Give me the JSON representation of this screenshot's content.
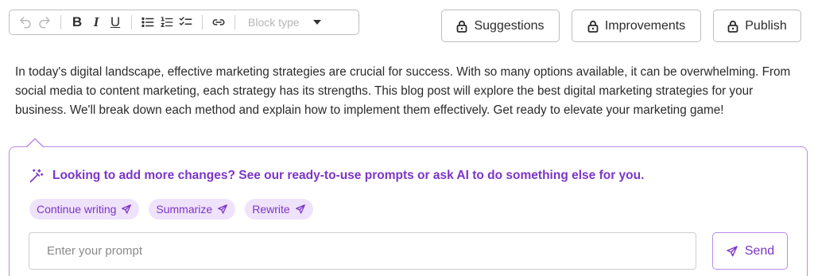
{
  "toolbar": {
    "undo_icon": "undo-icon",
    "redo_icon": "redo-icon",
    "bold_label": "B",
    "italic_label": "I",
    "underline_label": "U",
    "bullet_list_icon": "bullet-list-icon",
    "numbered_list_icon": "numbered-list-icon",
    "checklist_icon": "checklist-icon",
    "link_icon": "link-icon",
    "block_type_placeholder": "Block type"
  },
  "actions": {
    "suggestions": {
      "label": "Suggestions",
      "icon": "lock-icon"
    },
    "improvements": {
      "label": "Improvements",
      "icon": "lock-icon"
    },
    "publish": {
      "label": "Publish",
      "icon": "lock-icon"
    }
  },
  "content": {
    "paragraph": "In today's digital landscape, effective marketing strategies are crucial for success. With so many options available, it can be overwhelming. From social media to content marketing, each strategy has its strengths. This blog post will explore the best digital marketing strategies for your business. We'll break down each method and explain how to implement them effectively. Get ready to elevate your marketing game!"
  },
  "ai_panel": {
    "headline": "Looking to add more changes? See our ready-to-use prompts or ask AI to do something else for you.",
    "headline_icon": "magic-wand-icon",
    "chips": [
      {
        "label": "Continue writing",
        "icon": "send-icon"
      },
      {
        "label": "Summarize",
        "icon": "send-icon"
      },
      {
        "label": "Rewrite",
        "icon": "send-icon"
      }
    ],
    "prompt_placeholder": "Enter your prompt",
    "send_label": "Send",
    "send_icon": "send-icon"
  },
  "colors": {
    "accent": "#7c35c8",
    "accent_light": "#efe2fb",
    "panel_border": "#b98ae6",
    "border_gray": "#bdbdbd"
  }
}
